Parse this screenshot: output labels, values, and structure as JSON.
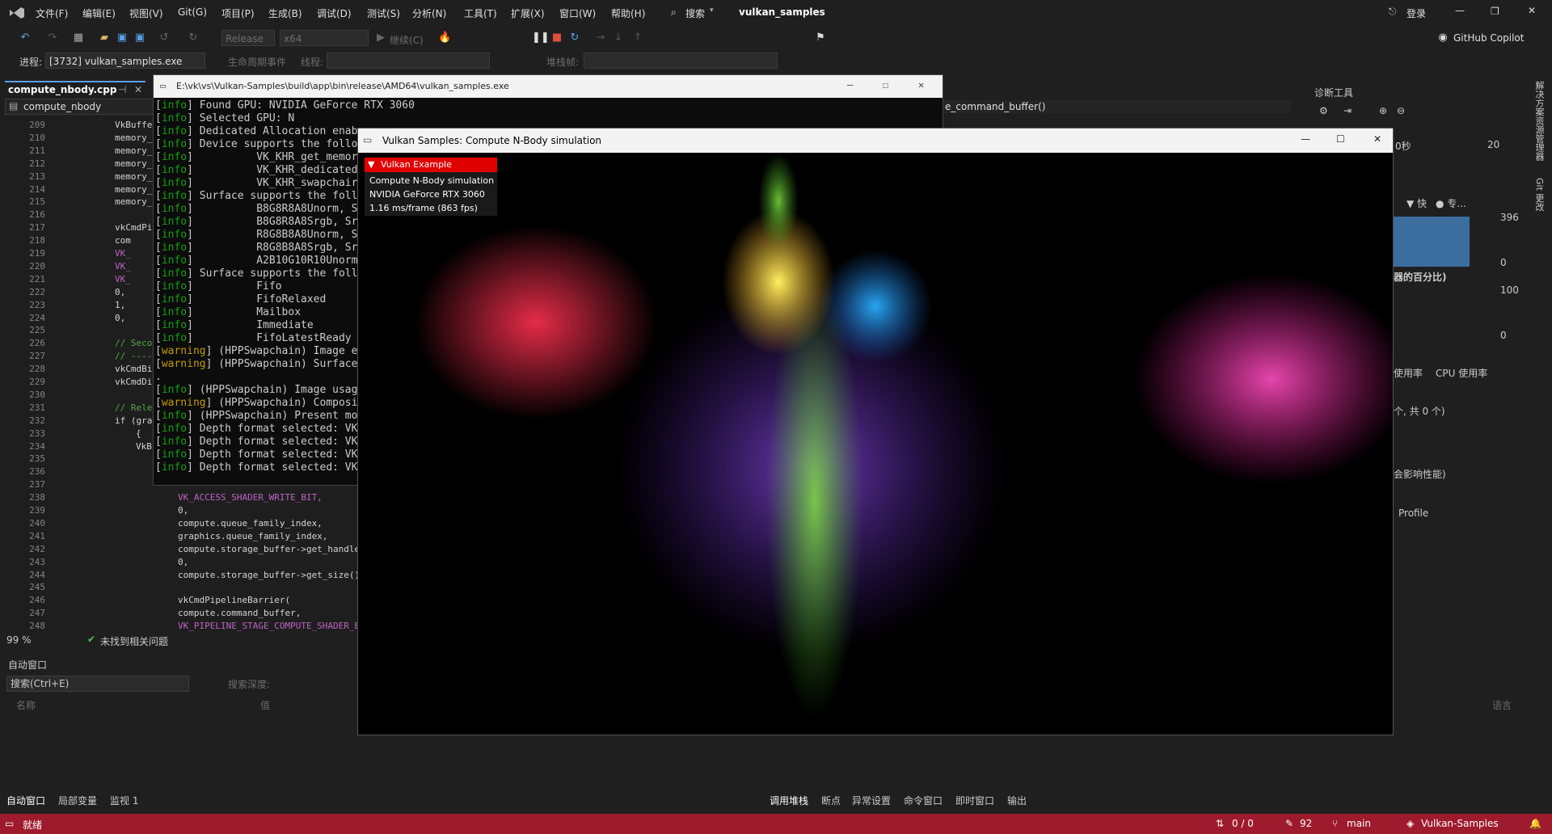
{
  "titlebar": {
    "menus": [
      "文件(F)",
      "编辑(E)",
      "视图(V)",
      "Git(G)",
      "项目(P)",
      "生成(B)",
      "调试(D)",
      "测试(S)",
      "分析(N)",
      "工具(T)",
      "扩展(X)",
      "窗口(W)",
      "帮助(H)"
    ],
    "search_label": "搜索",
    "solution_name": "vulkan_samples",
    "login_label": "登录",
    "copilot_label": "GitHub Copilot"
  },
  "toolbar": {
    "config": "Release",
    "platform": "x64",
    "continue_label": "继续(C)",
    "process_label": "进程:",
    "process_value": "[3732] vulkan_samples.exe",
    "lifecycle_label": "生命周期事件",
    "thread_label": "线程:",
    "stack_label": "堆栈帧:"
  },
  "editor": {
    "tab_label": "compute_nbody.cpp",
    "nav_label": "compute_nbody",
    "nav_right": "e_command_buffer()",
    "zoom": "99 %",
    "issues": "未找到相关问题",
    "lines": [
      {
        "no": "209",
        "text": "VkBuffe"
      },
      {
        "no": "210",
        "text": "memory_"
      },
      {
        "no": "211",
        "text": "memory_"
      },
      {
        "no": "212",
        "text": "memory_"
      },
      {
        "no": "213",
        "text": "memory_"
      },
      {
        "no": "214",
        "text": "memory_"
      },
      {
        "no": "215",
        "text": "memory_"
      },
      {
        "no": "216",
        "text": ""
      },
      {
        "no": "217",
        "text": "vkCmdPi"
      },
      {
        "no": "218",
        "text": "com"
      },
      {
        "no": "219",
        "text": "VK_"
      },
      {
        "no": "220",
        "text": "VK_"
      },
      {
        "no": "221",
        "text": "VK_"
      },
      {
        "no": "222",
        "text": "0,"
      },
      {
        "no": "223",
        "text": "1,"
      },
      {
        "no": "224",
        "text": "0,"
      },
      {
        "no": "225",
        "text": ""
      },
      {
        "no": "226",
        "text": "// Seco"
      },
      {
        "no": "227",
        "text": "// ----"
      },
      {
        "no": "228",
        "text": "vkCmdBi"
      },
      {
        "no": "229",
        "text": "vkCmdDi"
      },
      {
        "no": "230",
        "text": ""
      },
      {
        "no": "231",
        "text": "// Rele"
      },
      {
        "no": "232",
        "text": "if (gra"
      },
      {
        "no": "233",
        "text": "{"
      },
      {
        "no": "234",
        "text": "VkB"
      },
      {
        "no": "235",
        "text": ""
      },
      {
        "no": "236",
        "text": ""
      },
      {
        "no": "237",
        "text": ""
      },
      {
        "no": "238",
        "text": "VK_ACCESS_SHADER_WRITE_BIT,"
      },
      {
        "no": "239",
        "text": "0,"
      },
      {
        "no": "240",
        "text": "compute.queue_family_index,"
      },
      {
        "no": "241",
        "text": "graphics.queue_family_index,"
      },
      {
        "no": "242",
        "text": "compute.storage_buffer->get_handle"
      },
      {
        "no": "243",
        "text": "0,"
      },
      {
        "no": "244",
        "text": "compute.storage_buffer->get_size()"
      },
      {
        "no": "245",
        "text": ""
      },
      {
        "no": "246",
        "text": "vkCmdPipelineBarrier("
      },
      {
        "no": "247",
        "text": "compute.command_buffer,"
      },
      {
        "no": "248",
        "text": "VK_PIPELINE_STAGE_COMPUTE_SHADER_BIT,"
      }
    ]
  },
  "console": {
    "title": "E:\\vk\\vs\\Vulkan-Samples\\build\\app\\bin\\release\\AMD64\\vulkan_samples.exe",
    "lines": [
      "[info] Found GPU: NVIDIA GeForce RTX 3060",
      "[info] Selected GPU: N",
      "[info] Dedicated Allocation enab",
      "[info] Device supports the follo",
      "[info]          VK_KHR_get_memor",
      "[info]          VK_KHR_dedicated",
      "[info]          VK_KHR_swapchair",
      "[info] Surface supports the foll",
      "[info]          B8G8R8A8Unorm, S",
      "[info]          B8G8R8A8Srgb, Sr",
      "[info]          R8G8B8A8Unorm, S",
      "[info]          R8G8B8A8Srgb, Sr",
      "[info]          A2B10G10R10Unorm",
      "[info] Surface supports the foll",
      "[info]          Fifo",
      "[info]          FifoRelaxed",
      "[info]          Mailbox",
      "[info]          Immediate",
      "[info]          FifoLatestReady",
      "[warning] (HPPSwapchain) Image e",
      "[warning] (HPPSwapchain) Surface",
      ".",
      "[info] (HPPSwapchain) Image usag",
      "[warning] (HPPSwapchain) Composi",
      "[info] (HPPSwapchain) Present mo",
      "[info] Depth format selected: VK",
      "[info] Depth format selected: VK",
      "[info] Depth format selected: VK",
      "[info] Depth format selected: VK"
    ]
  },
  "vulkan": {
    "title": "Vulkan Samples: Compute N-Body simulation",
    "overlay_header": "Vulkan Example",
    "overlay_lines": [
      "Compute N-Body simulation",
      "NVIDIA GeForce RTX 3060",
      "1.16 ms/frame (863 fps)"
    ]
  },
  "diag": {
    "title": "诊断工具",
    "time_left": "0秒",
    "time_right": "20",
    "fast_label": "快",
    "pro_label": "专...",
    "val_396": "396",
    "val_0a": "0",
    "percent_label": "器的百分比)",
    "val_100": "100",
    "val_0b": "0",
    "tab_mem": "使用率",
    "tab_cpu": "CPU 使用率",
    "count_label": "个, 共 0 个)",
    "affect_label": "会影响性能)",
    "profile_label": "Profile"
  },
  "auto_window": {
    "title": "自动窗口",
    "search_placeholder": "搜索(Ctrl+E)",
    "depth_label": "搜索深度:",
    "col_name": "名称",
    "col_value": "值",
    "col_lang": "语言",
    "tabs_left": [
      "自动窗口",
      "局部变量",
      "监视 1"
    ],
    "tabs_right": [
      "调用堆栈",
      "断点",
      "异常设置",
      "命令窗口",
      "即时窗口",
      "输出"
    ]
  },
  "right_rail": [
    "解决方案资源管理器",
    "Git 更改"
  ],
  "statusbar": {
    "ready": "就绪",
    "errors": "0 / 0",
    "edits": "92",
    "branch": "main",
    "repo": "Vulkan-Samples"
  },
  "colors": {
    "statusbar": "#9e1a2d",
    "overlay_header": "#e00000",
    "console_info": "#13a10e",
    "console_warning": "#c19c00"
  }
}
